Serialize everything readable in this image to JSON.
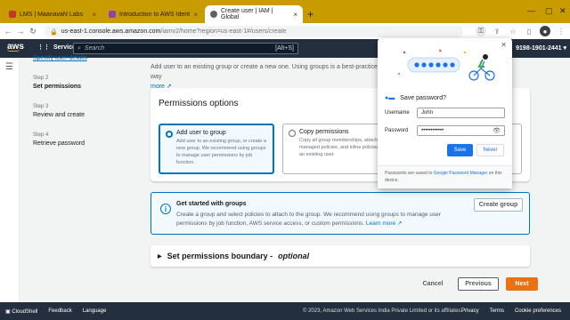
{
  "browser": {
    "tabs": [
      {
        "title": "LMS | MaanavaN Labs",
        "active": false,
        "favicon_color": "#c0392b"
      },
      {
        "title": "Introduction to AWS Identity Acc",
        "active": false,
        "favicon_color": "#8e44ad"
      },
      {
        "title": "Create user | IAM | Global",
        "active": true,
        "favicon_color": "#5f6368"
      }
    ],
    "url_host": "us-east-1.console.aws.amazon.com",
    "url_path": "/iamv2/home?region=us-east-1#/users/create"
  },
  "aws_nav": {
    "logo": "aws",
    "services_label": "Services",
    "search_placeholder": "Search",
    "search_shortcut": "[Alt+S]",
    "account": "9198-1901-2441"
  },
  "wizard": {
    "step1_link": "Specify user details",
    "steps": [
      {
        "num": "Step 2",
        "title": "Set permissions",
        "current": true
      },
      {
        "num": "Step 3",
        "title": "Review and create",
        "current": false
      },
      {
        "num": "Step 4",
        "title": "Retrieve password",
        "current": false
      }
    ]
  },
  "intro": {
    "text": "Add user to an existing group or create a new one. Using groups is a best-practice way",
    "more": "more"
  },
  "permissions": {
    "title": "Permissions options",
    "options": [
      {
        "label": "Add user to group",
        "desc": "Add user to an existing group, or create a new group. We recommend using groups to manage user permissions by job function.",
        "selected": true
      },
      {
        "label": "Copy permissions",
        "desc": "Copy all group memberships, attached managed policies, and inline policies from an existing user.",
        "selected": false
      },
      {
        "label": "",
        "desc": "",
        "selected": false
      }
    ]
  },
  "info": {
    "title": "Get started with groups",
    "body": "Create a group and select policies to attach to the group. We recommend using groups to manage user permissions by job function, AWS service access, or custom permissions.",
    "learn_more": "Learn more",
    "button": "Create group"
  },
  "boundary": {
    "title": "Set permissions boundary -",
    "optional": "optional"
  },
  "actions": {
    "cancel": "Cancel",
    "previous": "Previous",
    "next": "Next"
  },
  "footer": {
    "cloudshell": "CloudShell",
    "feedback": "Feedback",
    "language": "Language",
    "copyright": "© 2023, Amazon Web Services India Private Limited or its affiliates.",
    "privacy": "Privacy",
    "terms": "Terms",
    "cookies": "Cookie preferences"
  },
  "password_popup": {
    "title": "Save password?",
    "username_label": "Username",
    "username_value": "John",
    "password_label": "Password",
    "password_value": "••••••••••••",
    "save": "Save",
    "never": "Never",
    "footer_text": "Passwords are saved to",
    "footer_link": "Google Password Manager",
    "footer_tail": "on this device."
  },
  "colors": {
    "tabstrip": "#c89b00",
    "aws_nav": "#232f3e",
    "aws_orange": "#ec7211",
    "aws_blue": "#0073bb",
    "google_blue": "#1a73e8"
  }
}
